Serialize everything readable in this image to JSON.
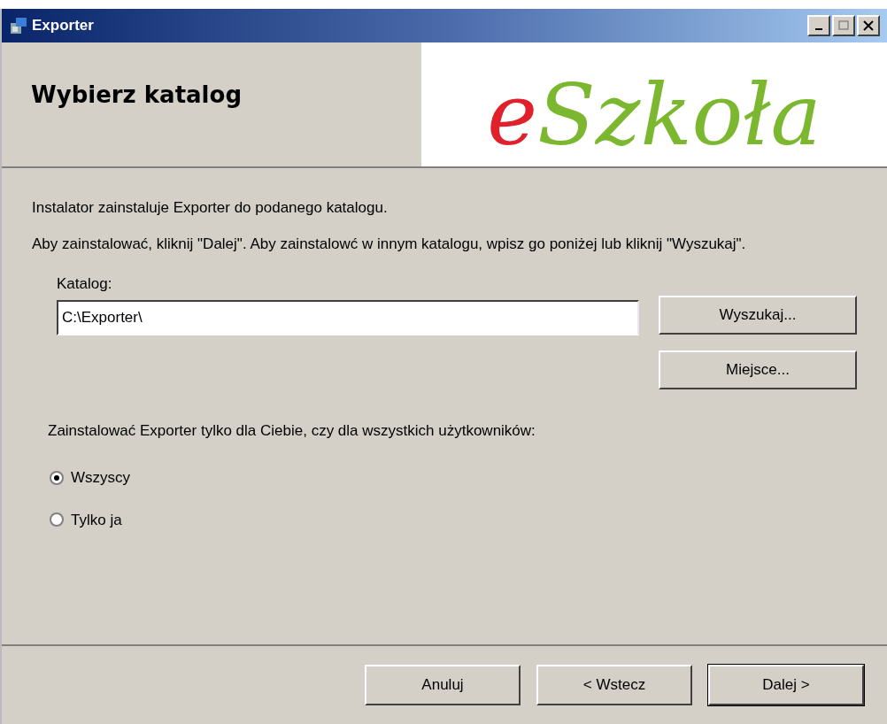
{
  "window": {
    "title": "Exporter"
  },
  "header": {
    "title": "Wybierz katalog",
    "logo": "eSzkoła"
  },
  "intro": [
    "Instalator zainstaluje Exporter do podanego katalogu.",
    "Aby zainstalować, kliknij \"Dalej\". Aby zainstalowć w innym katalogu, wpisz go poniżej lub kliknij \"Wyszukaj\"."
  ],
  "folder": {
    "label": "Katalog:",
    "value": "C:\\Exporter\\",
    "buttons": [
      "Wyszukaj...",
      "Miejsce..."
    ]
  },
  "scope": {
    "question": "Zainstalować Exporter tylko dla Ciebie, czy dla wszystkich użytkowników:",
    "options": [
      {
        "label": "Wszyscy",
        "selected": true
      },
      {
        "label": "Tylko ja",
        "selected": false
      }
    ]
  },
  "footer": {
    "buttons": [
      {
        "label": "Anuluj",
        "default": false
      },
      {
        "label": "< Wstecz",
        "default": false
      },
      {
        "label": "Dalej >",
        "default": true
      }
    ]
  }
}
